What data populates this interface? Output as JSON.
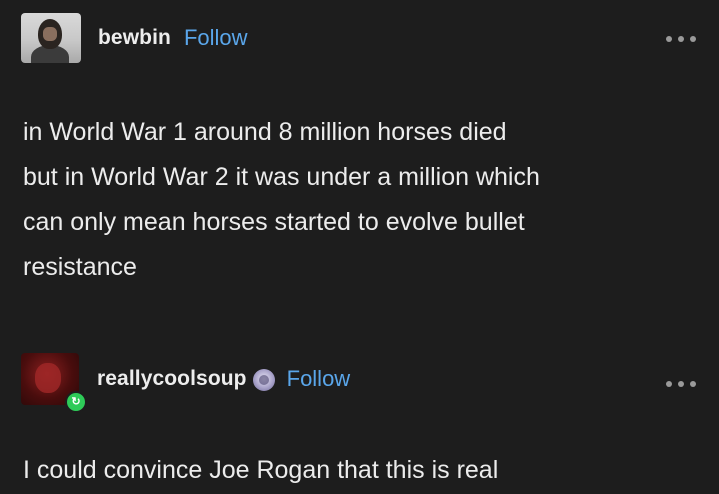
{
  "posts": [
    {
      "username": "bewbin",
      "follow_label": "Follow",
      "avatar_icon": "person-avatar",
      "text": "in World War 1 around 8 million horses died\nbut in World War 2 it was under a million which\ncan only mean horses started to evolve bullet\nresistance"
    },
    {
      "username": "reallycoolsoup",
      "follow_label": "Follow",
      "avatar_icon": "red-avatar",
      "badge_icon": "reblog-icon",
      "emoji_icon": "emoji-badge-icon",
      "text": "I could convince Joe Rogan that this is real"
    }
  ],
  "colors": {
    "background": "#1d1d1d",
    "follow": "#5aa6ea",
    "text": "#ececec",
    "badge": "#2ecb58"
  }
}
